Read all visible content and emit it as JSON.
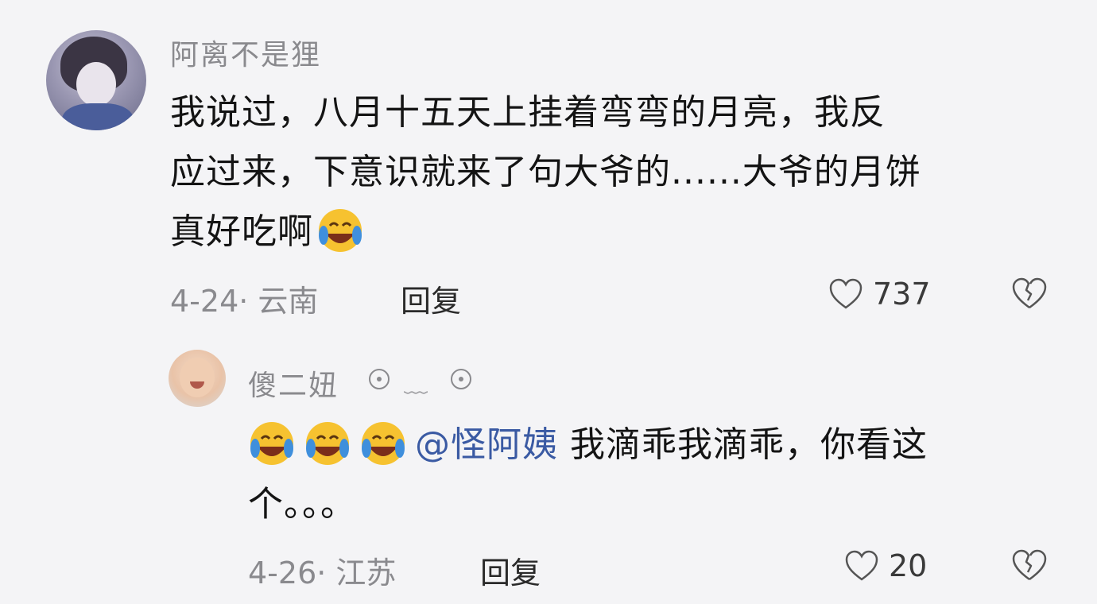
{
  "comment": {
    "username": "阿离不是狸",
    "lines": [
      "我说过，八月十五天上挂着弯弯的月亮，我反",
      "应过来，下意识就来了句大爷的......大爷的月饼",
      "真好吃啊"
    ],
    "date_location": "4-24· 云南",
    "reply_label": "回复",
    "like_count": "737",
    "emoji": "laugh-cry-emoji"
  },
  "reply": {
    "username": "傻二妞",
    "badge_icon": "badge-icon",
    "suffix": "﹏",
    "mention": "@怪阿姨",
    "text_line1": "我滴乖我滴乖，你看这",
    "text_line2": "个。。。",
    "emoji_count": 3,
    "date_location": "4-26· 江苏",
    "reply_label": "回复",
    "like_count": "20"
  },
  "colors": {
    "background": "#f4f4f6",
    "text": "#141414",
    "muted": "#8a8a8e",
    "mention": "#3a5aa3",
    "emoji_face": "#f6c230"
  }
}
